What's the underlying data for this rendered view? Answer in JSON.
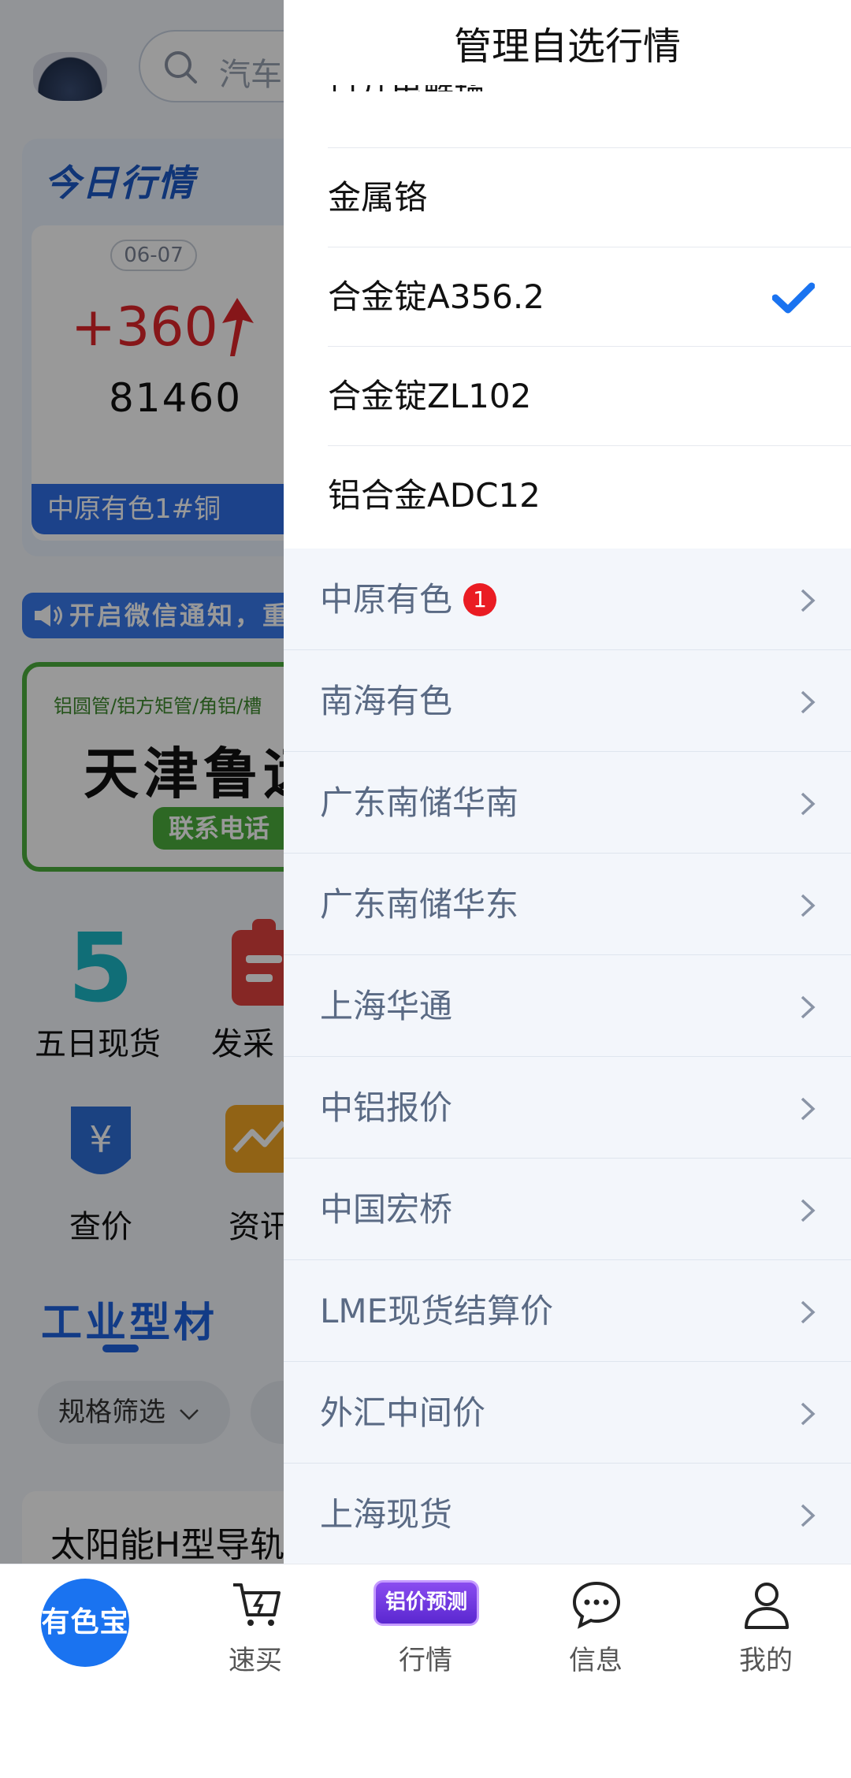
{
  "background": {
    "search_placeholder": "汽车",
    "today_title": "今日行情",
    "date": "06-07",
    "change": "+360",
    "price": "81460",
    "price_label": "中原有色1#铜",
    "notice": "开启微信通知，重",
    "ad": {
      "small": "铝圆管/铝方矩管/角铝/槽",
      "big": "天津鲁远",
      "phone": "联系电话"
    },
    "quick_links": [
      {
        "label": "五日现货",
        "icon": "five-icon",
        "number": "5"
      },
      {
        "label": "发采",
        "icon": "clipboard-icon"
      },
      {
        "label": "查价",
        "icon": "yen-shield-icon"
      },
      {
        "label": "资讯",
        "icon": "chart-icon"
      }
    ],
    "section_title": "工业型材",
    "filter_label": "规格筛选",
    "product_title": "太阳能H型导轨"
  },
  "drawer": {
    "title": "管理自选行情",
    "clipped_item": "日丌电解锰",
    "sub_items": [
      {
        "label": "金属铬",
        "checked": false
      },
      {
        "label": "合金锭A356.2",
        "checked": true
      },
      {
        "label": "合金锭ZL102",
        "checked": false
      },
      {
        "label": "铝合金ADC12",
        "checked": false
      }
    ],
    "categories": [
      {
        "label": "中原有色",
        "badge": "1"
      },
      {
        "label": "南海有色"
      },
      {
        "label": "广东南储华南"
      },
      {
        "label": "广东南储华东"
      },
      {
        "label": "上海华通"
      },
      {
        "label": "中铝报价"
      },
      {
        "label": "中国宏桥"
      },
      {
        "label": "LME现货结算价"
      },
      {
        "label": "外汇中间价"
      },
      {
        "label": "上海现货"
      }
    ],
    "colors": {
      "check": "#1a73f0",
      "badge": "#ea1c23"
    }
  },
  "tabbar": {
    "home": "有色宝",
    "buy": "速买",
    "promo": "铝价预测",
    "market": "行情",
    "message": "信息",
    "mine": "我的"
  }
}
